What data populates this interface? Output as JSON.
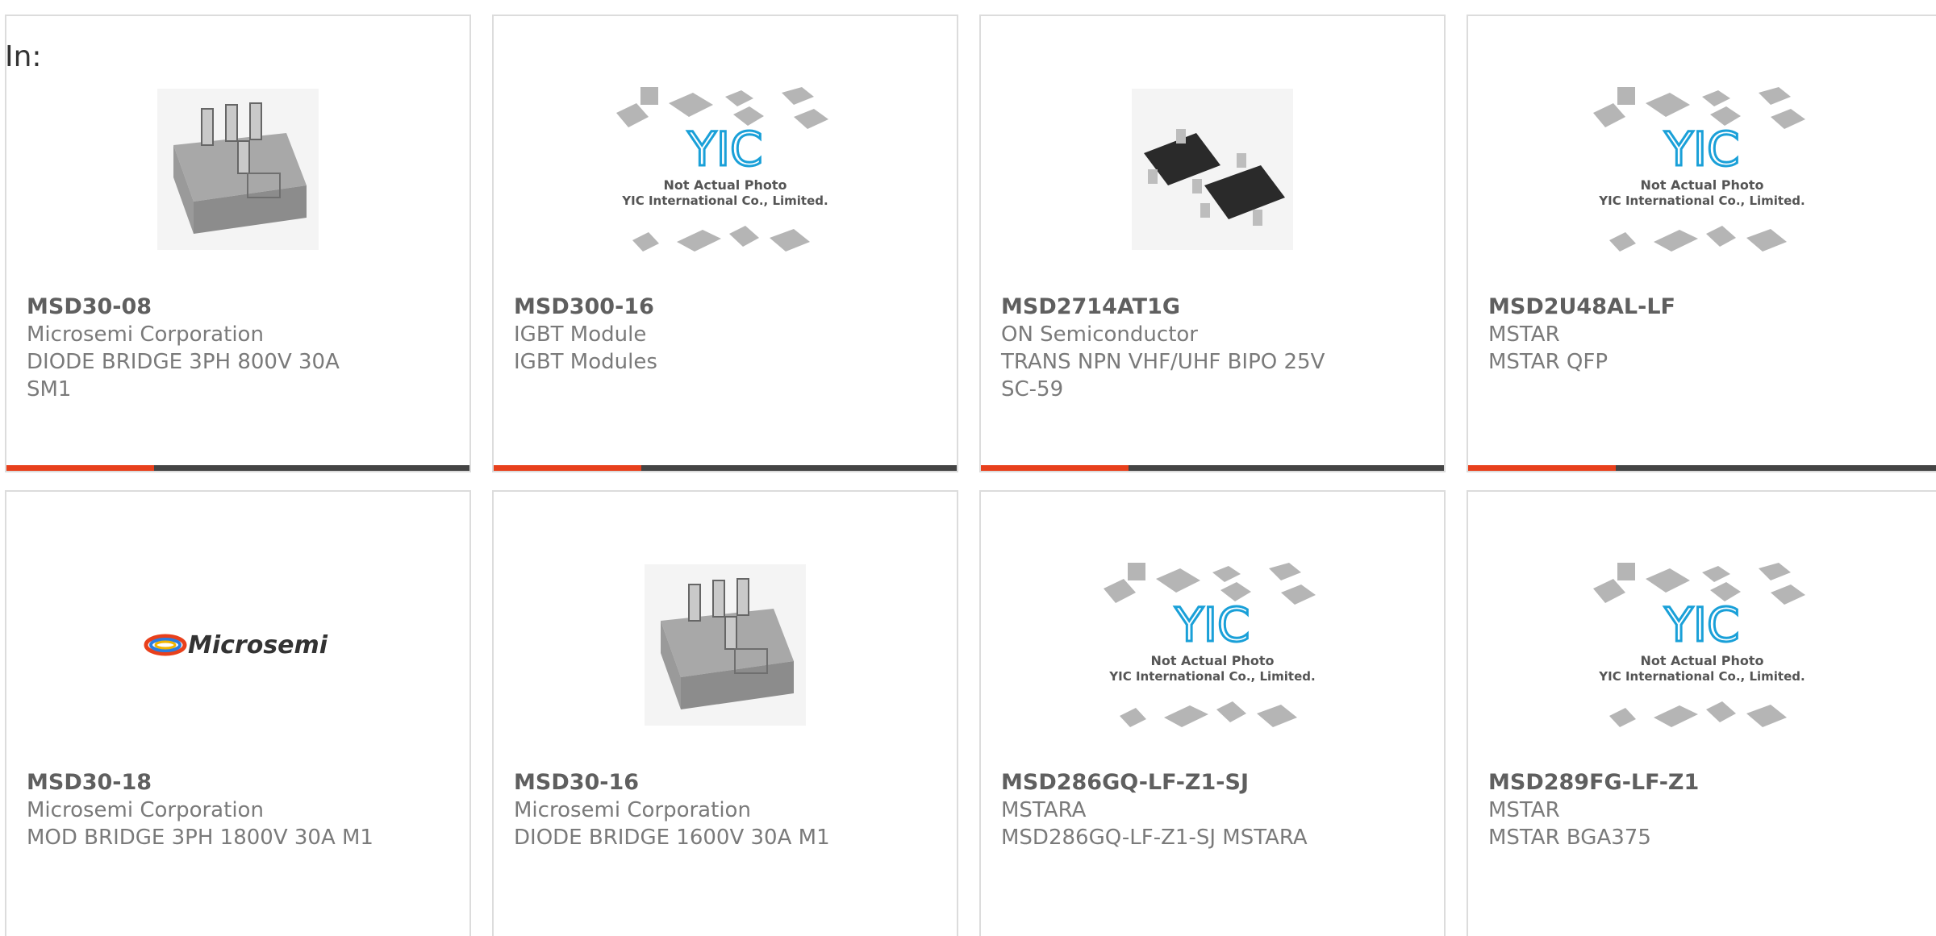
{
  "header": {
    "in_label": "In:"
  },
  "colors": {
    "accent": "#e8401c",
    "bar": "#444444",
    "border": "#dcdcdc",
    "title": "#5f5f5f",
    "text": "#7a7a7a"
  },
  "products": [
    {
      "part": "MSD30-08",
      "line1": "Microsemi Corporation",
      "line2": "DIODE BRIDGE 3PH 800V 30A",
      "line3": "SM1",
      "image": "bridge-module-photo"
    },
    {
      "part": "MSD300-16",
      "line1": "IGBT Module",
      "line2": "IGBT Modules",
      "line3": "",
      "image": "yic-placeholder",
      "placeholder_l1": "Not Actual Photo",
      "placeholder_l2": "YIC International Co., Limited."
    },
    {
      "part": "MSD2714AT1G",
      "line1": "ON Semiconductor",
      "line2": "TRANS NPN VHF/UHF BIPO 25V",
      "line3": "SC-59",
      "image": "sot-transistor-photo"
    },
    {
      "part": "MSD2U48AL-LF",
      "line1": "MSTAR",
      "line2": "MSTAR QFP",
      "line3": "",
      "image": "yic-placeholder",
      "placeholder_l1": "Not Actual Photo",
      "placeholder_l2": "YIC International Co., Limited."
    },
    {
      "part": "MSD30-18",
      "line1": "Microsemi Corporation",
      "line2": "MOD BRIDGE 3PH 1800V 30A M1",
      "line3": "",
      "image": "microsemi-logo",
      "logo_text": "Microsemi"
    },
    {
      "part": "MSD30-16",
      "line1": "Microsemi Corporation",
      "line2": "DIODE BRIDGE 1600V 30A M1",
      "line3": "",
      "image": "bridge-module-photo"
    },
    {
      "part": "MSD286GQ-LF-Z1-SJ",
      "line1": "MSTARA",
      "line2": "MSD286GQ-LF-Z1-SJ MSTARA",
      "line3": "",
      "image": "yic-placeholder",
      "placeholder_l1": "Not Actual Photo",
      "placeholder_l2": "YIC International Co., Limited."
    },
    {
      "part": "MSD289FG-LF-Z1",
      "line1": "MSTAR",
      "line2": "MSTAR BGA375",
      "line3": "",
      "image": "yic-placeholder",
      "placeholder_l1": "Not Actual Photo",
      "placeholder_l2": "YIC International Co., Limited."
    }
  ]
}
